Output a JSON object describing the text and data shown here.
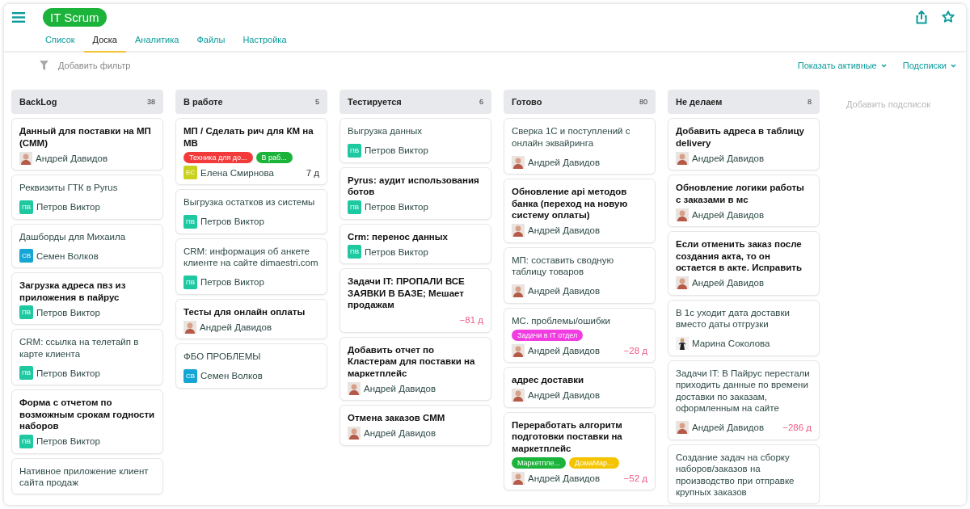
{
  "header": {
    "title": "IT Scrum"
  },
  "tabs": [
    {
      "label": "Список",
      "selected": false
    },
    {
      "label": "Доска",
      "selected": true
    },
    {
      "label": "Аналитика",
      "selected": false
    },
    {
      "label": "Файлы",
      "selected": false
    },
    {
      "label": "Настройка",
      "selected": false
    }
  ],
  "filter": {
    "placeholder": "Добавить фильтр"
  },
  "toolbar": [
    "Показать активные",
    "Подсписки"
  ],
  "columns": [
    {
      "title": "BackLog",
      "count": "38",
      "cards": [
        {
          "title": "Данный для поставки на МП (СММ)",
          "unread": true,
          "assignee": {
            "name": "Андрей Давидов",
            "avatar": {
              "kind": "photo"
            }
          }
        },
        {
          "title": "Реквизиты ГТК в Pyrus",
          "unread": false,
          "assignee": {
            "name": "Петров Виктор",
            "avatar": {
              "kind": "initials",
              "initials": "ПВ",
              "color": "#1ec8a0"
            }
          }
        },
        {
          "title": "Дашборды для Михаила",
          "unread": false,
          "assignee": {
            "name": "Семен Волков",
            "avatar": {
              "kind": "initials",
              "initials": "СВ",
              "color": "#16a6d6"
            }
          }
        },
        {
          "title": "Загрузка адреса пвз из приложения в пайрус",
          "unread": true,
          "assignee": {
            "name": "Петров Виктор",
            "avatar": {
              "kind": "initials",
              "initials": "ПВ",
              "color": "#1ec8a0"
            }
          }
        },
        {
          "title": "CRM: ссылка на телетайп в карте клиента",
          "unread": false,
          "assignee": {
            "name": "Петров Виктор",
            "avatar": {
              "kind": "initials",
              "initials": "ПВ",
              "color": "#1ec8a0"
            }
          }
        },
        {
          "title": "Форма с отчетом по возможным срокам годности наборов",
          "unread": true,
          "assignee": {
            "name": "Петров Виктор",
            "avatar": {
              "kind": "initials",
              "initials": "ПВ",
              "color": "#1ec8a0"
            }
          }
        },
        {
          "title": "Нативное приложение клиент сайта продаж",
          "unread": false
        }
      ]
    },
    {
      "title": "В работе",
      "count": "5",
      "cards": [
        {
          "title": "МП / Сделать рич для КМ на МВ",
          "unread": true,
          "tags": [
            {
              "label": "Техника для до...",
              "color": "#f23a3a"
            },
            {
              "label": "В раб...",
              "color": "#1bb33a"
            }
          ],
          "assignee": {
            "name": "Елена Смирнова",
            "avatar": {
              "kind": "initials",
              "initials": "ЕС",
              "color": "#c8d21e"
            }
          },
          "due": {
            "text": "7 д",
            "overdue": false
          }
        },
        {
          "title": "Выгрузка остатков из системы",
          "unread": false,
          "assignee": {
            "name": "Петров Виктор",
            "avatar": {
              "kind": "initials",
              "initials": "ПВ",
              "color": "#1ec8a0"
            }
          }
        },
        {
          "title": "CRM: информация об анкете клиенте на сайте dimaestri.com",
          "unread": false,
          "assignee": {
            "name": "Петров Виктор",
            "avatar": {
              "kind": "initials",
              "initials": "ПВ",
              "color": "#1ec8a0"
            }
          }
        },
        {
          "title": "Тесты для онлайн оплаты",
          "unread": true,
          "assignee": {
            "name": "Андрей Давидов",
            "avatar": {
              "kind": "photo"
            }
          }
        },
        {
          "title": "ФБО ПРОБЛЕМЫ",
          "unread": false,
          "assignee": {
            "name": "Семен Волков",
            "avatar": {
              "kind": "initials",
              "initials": "СВ",
              "color": "#16a6d6"
            }
          }
        }
      ]
    },
    {
      "title": "Тестируется",
      "count": "6",
      "cards": [
        {
          "title": "Выгрузка данных",
          "unread": false,
          "assignee": {
            "name": "Петров Виктор",
            "avatar": {
              "kind": "initials",
              "initials": "ПВ",
              "color": "#1ec8a0"
            }
          }
        },
        {
          "title": "Pyrus: аудит использования ботов",
          "unread": true,
          "assignee": {
            "name": "Петров Виктор",
            "avatar": {
              "kind": "initials",
              "initials": "ПВ",
              "color": "#1ec8a0"
            }
          }
        },
        {
          "title": "Crm: перенос данных",
          "unread": true,
          "assignee": {
            "name": "Петров Виктор",
            "avatar": {
              "kind": "initials",
              "initials": "ПВ",
              "color": "#1ec8a0"
            }
          }
        },
        {
          "title": "Задачи IT: ПРОПАЛИ ВСЕ ЗАЯВКИ В БАЗЕ; Мешает продажам",
          "unread": true,
          "due": {
            "text": "−81 д",
            "overdue": true
          }
        },
        {
          "title": "Добавить отчет по Кластерам для поставки на маркетплейс",
          "unread": true,
          "assignee": {
            "name": "Андрей Давидов",
            "avatar": {
              "kind": "photo"
            }
          }
        },
        {
          "title": "Отмена заказов СММ",
          "unread": true,
          "assignee": {
            "name": "Андрей Давидов",
            "avatar": {
              "kind": "photo"
            }
          }
        }
      ]
    },
    {
      "title": "Готово",
      "count": "80",
      "cards": [
        {
          "title": "Сверка 1С и поступлений с онлайн эквайринга",
          "unread": false,
          "assignee": {
            "name": "Андрей Давидов",
            "avatar": {
              "kind": "photo"
            }
          }
        },
        {
          "title": "Обновление api методов банка (переход на новую систему оплаты)",
          "unread": true,
          "assignee": {
            "name": "Андрей Давидов",
            "avatar": {
              "kind": "photo"
            }
          }
        },
        {
          "title": "МП: составить сводную таблицу товаров",
          "unread": false,
          "assignee": {
            "name": "Андрей Давидов",
            "avatar": {
              "kind": "photo"
            }
          }
        },
        {
          "title": "МС. проблемы/ошибки",
          "unread": false,
          "tags": [
            {
              "label": "Задачи в IT отдел",
              "color": "#f03ce0"
            }
          ],
          "assignee": {
            "name": "Андрей Давидов",
            "avatar": {
              "kind": "photo"
            }
          },
          "due": {
            "text": "−28 д",
            "overdue": true
          }
        },
        {
          "title": "адрес доставки",
          "unread": true,
          "assignee": {
            "name": "Андрей Давидов",
            "avatar": {
              "kind": "photo"
            }
          }
        },
        {
          "title": "Переработать алгоритм подготовки поставки на маркетплейс",
          "unread": true,
          "tags": [
            {
              "label": "Маркетпле...",
              "color": "#1bb33a"
            },
            {
              "label": "ДомаМар...",
              "color": "#f5c400"
            }
          ],
          "assignee": {
            "name": "Андрей Давидов",
            "avatar": {
              "kind": "photo"
            }
          },
          "due": {
            "text": "−52 д",
            "overdue": true
          }
        }
      ]
    },
    {
      "title": "Не делаем",
      "count": "8",
      "cards": [
        {
          "title": "Добавить адреса в таблицу delivery",
          "unread": true,
          "assignee": {
            "name": "Андрей Давидов",
            "avatar": {
              "kind": "photo"
            }
          }
        },
        {
          "title": "Обновление логики работы с заказами в мс",
          "unread": true,
          "assignee": {
            "name": "Андрей Давидов",
            "avatar": {
              "kind": "photo"
            }
          }
        },
        {
          "title": "Если отменить заказ после создания акта, то он остается в акте. Исправить",
          "unread": true,
          "assignee": {
            "name": "Андрей Давидов",
            "avatar": {
              "kind": "photo"
            }
          }
        },
        {
          "title": "В 1с уходит дата доставки вместо даты отгрузки",
          "unread": false,
          "assignee": {
            "name": "Марина Соколова",
            "avatar": {
              "kind": "figure"
            }
          }
        },
        {
          "title": "Задачи IT: В Пайрус перестали приходить данные по времени доставки по заказам, оформленным на сайте",
          "unread": false,
          "assignee": {
            "name": "Андрей Давидов",
            "avatar": {
              "kind": "photo"
            }
          },
          "due": {
            "text": "−286 д",
            "overdue": true
          }
        },
        {
          "title": "Создание задач на сборку наборов/заказов на производство при отправке крупных заказов",
          "unread": false
        }
      ]
    }
  ],
  "add_sublist": "Добавить подсписок"
}
